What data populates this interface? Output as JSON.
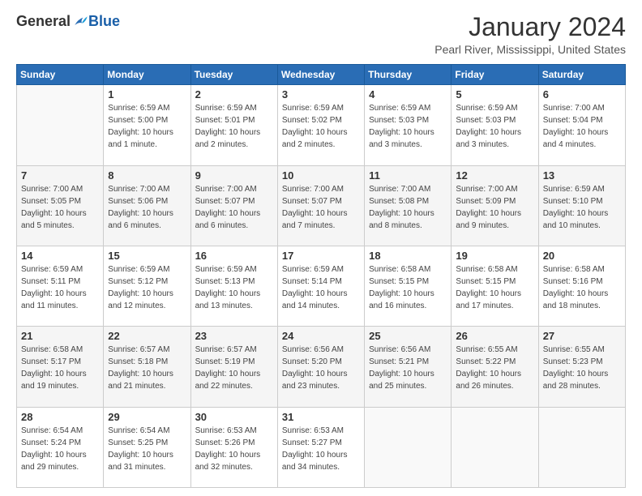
{
  "logo": {
    "general": "General",
    "blue": "Blue"
  },
  "header": {
    "month": "January 2024",
    "location": "Pearl River, Mississippi, United States"
  },
  "weekdays": [
    "Sunday",
    "Monday",
    "Tuesday",
    "Wednesday",
    "Thursday",
    "Friday",
    "Saturday"
  ],
  "weeks": [
    [
      {
        "day": "",
        "info": ""
      },
      {
        "day": "1",
        "info": "Sunrise: 6:59 AM\nSunset: 5:00 PM\nDaylight: 10 hours\nand 1 minute."
      },
      {
        "day": "2",
        "info": "Sunrise: 6:59 AM\nSunset: 5:01 PM\nDaylight: 10 hours\nand 2 minutes."
      },
      {
        "day": "3",
        "info": "Sunrise: 6:59 AM\nSunset: 5:02 PM\nDaylight: 10 hours\nand 2 minutes."
      },
      {
        "day": "4",
        "info": "Sunrise: 6:59 AM\nSunset: 5:03 PM\nDaylight: 10 hours\nand 3 minutes."
      },
      {
        "day": "5",
        "info": "Sunrise: 6:59 AM\nSunset: 5:03 PM\nDaylight: 10 hours\nand 3 minutes."
      },
      {
        "day": "6",
        "info": "Sunrise: 7:00 AM\nSunset: 5:04 PM\nDaylight: 10 hours\nand 4 minutes."
      }
    ],
    [
      {
        "day": "7",
        "info": "Sunrise: 7:00 AM\nSunset: 5:05 PM\nDaylight: 10 hours\nand 5 minutes."
      },
      {
        "day": "8",
        "info": "Sunrise: 7:00 AM\nSunset: 5:06 PM\nDaylight: 10 hours\nand 6 minutes."
      },
      {
        "day": "9",
        "info": "Sunrise: 7:00 AM\nSunset: 5:07 PM\nDaylight: 10 hours\nand 6 minutes."
      },
      {
        "day": "10",
        "info": "Sunrise: 7:00 AM\nSunset: 5:07 PM\nDaylight: 10 hours\nand 7 minutes."
      },
      {
        "day": "11",
        "info": "Sunrise: 7:00 AM\nSunset: 5:08 PM\nDaylight: 10 hours\nand 8 minutes."
      },
      {
        "day": "12",
        "info": "Sunrise: 7:00 AM\nSunset: 5:09 PM\nDaylight: 10 hours\nand 9 minutes."
      },
      {
        "day": "13",
        "info": "Sunrise: 6:59 AM\nSunset: 5:10 PM\nDaylight: 10 hours\nand 10 minutes."
      }
    ],
    [
      {
        "day": "14",
        "info": "Sunrise: 6:59 AM\nSunset: 5:11 PM\nDaylight: 10 hours\nand 11 minutes."
      },
      {
        "day": "15",
        "info": "Sunrise: 6:59 AM\nSunset: 5:12 PM\nDaylight: 10 hours\nand 12 minutes."
      },
      {
        "day": "16",
        "info": "Sunrise: 6:59 AM\nSunset: 5:13 PM\nDaylight: 10 hours\nand 13 minutes."
      },
      {
        "day": "17",
        "info": "Sunrise: 6:59 AM\nSunset: 5:14 PM\nDaylight: 10 hours\nand 14 minutes."
      },
      {
        "day": "18",
        "info": "Sunrise: 6:58 AM\nSunset: 5:15 PM\nDaylight: 10 hours\nand 16 minutes."
      },
      {
        "day": "19",
        "info": "Sunrise: 6:58 AM\nSunset: 5:15 PM\nDaylight: 10 hours\nand 17 minutes."
      },
      {
        "day": "20",
        "info": "Sunrise: 6:58 AM\nSunset: 5:16 PM\nDaylight: 10 hours\nand 18 minutes."
      }
    ],
    [
      {
        "day": "21",
        "info": "Sunrise: 6:58 AM\nSunset: 5:17 PM\nDaylight: 10 hours\nand 19 minutes."
      },
      {
        "day": "22",
        "info": "Sunrise: 6:57 AM\nSunset: 5:18 PM\nDaylight: 10 hours\nand 21 minutes."
      },
      {
        "day": "23",
        "info": "Sunrise: 6:57 AM\nSunset: 5:19 PM\nDaylight: 10 hours\nand 22 minutes."
      },
      {
        "day": "24",
        "info": "Sunrise: 6:56 AM\nSunset: 5:20 PM\nDaylight: 10 hours\nand 23 minutes."
      },
      {
        "day": "25",
        "info": "Sunrise: 6:56 AM\nSunset: 5:21 PM\nDaylight: 10 hours\nand 25 minutes."
      },
      {
        "day": "26",
        "info": "Sunrise: 6:55 AM\nSunset: 5:22 PM\nDaylight: 10 hours\nand 26 minutes."
      },
      {
        "day": "27",
        "info": "Sunrise: 6:55 AM\nSunset: 5:23 PM\nDaylight: 10 hours\nand 28 minutes."
      }
    ],
    [
      {
        "day": "28",
        "info": "Sunrise: 6:54 AM\nSunset: 5:24 PM\nDaylight: 10 hours\nand 29 minutes."
      },
      {
        "day": "29",
        "info": "Sunrise: 6:54 AM\nSunset: 5:25 PM\nDaylight: 10 hours\nand 31 minutes."
      },
      {
        "day": "30",
        "info": "Sunrise: 6:53 AM\nSunset: 5:26 PM\nDaylight: 10 hours\nand 32 minutes."
      },
      {
        "day": "31",
        "info": "Sunrise: 6:53 AM\nSunset: 5:27 PM\nDaylight: 10 hours\nand 34 minutes."
      },
      {
        "day": "",
        "info": ""
      },
      {
        "day": "",
        "info": ""
      },
      {
        "day": "",
        "info": ""
      }
    ]
  ]
}
